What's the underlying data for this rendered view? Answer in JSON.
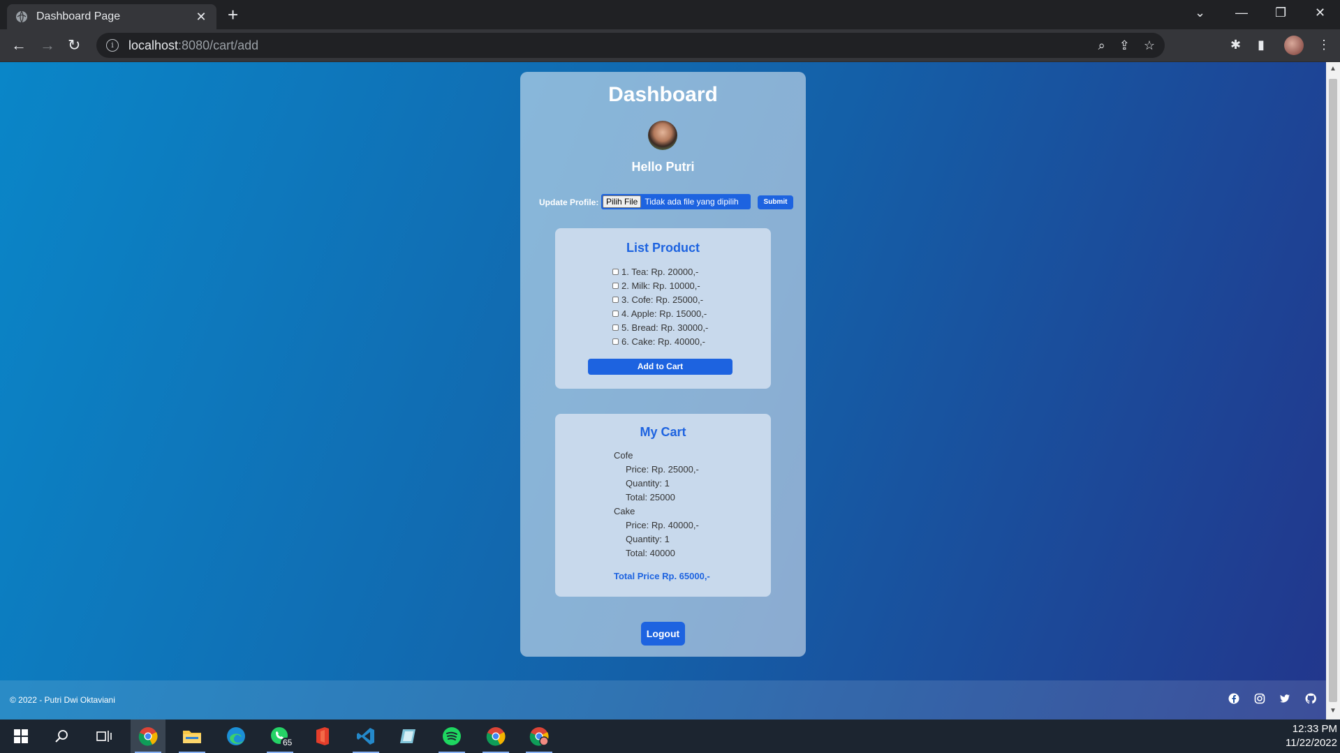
{
  "browser": {
    "tab_title": "Dashboard Page",
    "url_host": "localhost",
    "url_path": ":8080/cart/add"
  },
  "dashboard": {
    "title": "Dashboard",
    "greeting": "Hello Putri",
    "update_label": "Update Profile:",
    "file_button": "Pilih File",
    "file_status": "Tidak ada file yang dipilih",
    "submit_label": "Submit"
  },
  "list_product": {
    "title": "List Product",
    "items": [
      "1. Tea: Rp. 20000,-",
      "2. Milk: Rp. 10000,-",
      "3. Cofe: Rp. 25000,-",
      "4. Apple: Rp. 15000,-",
      "5. Bread: Rp. 30000,-",
      "6. Cake: Rp. 40000,-"
    ],
    "add_button": "Add to Cart"
  },
  "cart": {
    "title": "My Cart",
    "items": [
      {
        "name": "Cofe",
        "price": "Price: Rp. 25000,-",
        "quantity": "Quantity: 1",
        "total": "Total: 25000"
      },
      {
        "name": "Cake",
        "price": "Price: Rp. 40000,-",
        "quantity": "Quantity: 1",
        "total": "Total: 40000"
      }
    ],
    "total_price": "Total Price Rp. 65000,-"
  },
  "logout_label": "Logout",
  "footer": {
    "copyright": "© 2022 - Putri Dwi Oktaviani",
    "social_icons": [
      "facebook-icon",
      "instagram-icon",
      "twitter-icon",
      "github-icon"
    ]
  },
  "taskbar": {
    "whatsapp_badge": "65",
    "time": "12:33 PM",
    "date": "11/22/2022"
  },
  "colors": {
    "accent": "#1d63e0",
    "bg_start": "#0a86c8",
    "bg_end": "#22368c"
  }
}
